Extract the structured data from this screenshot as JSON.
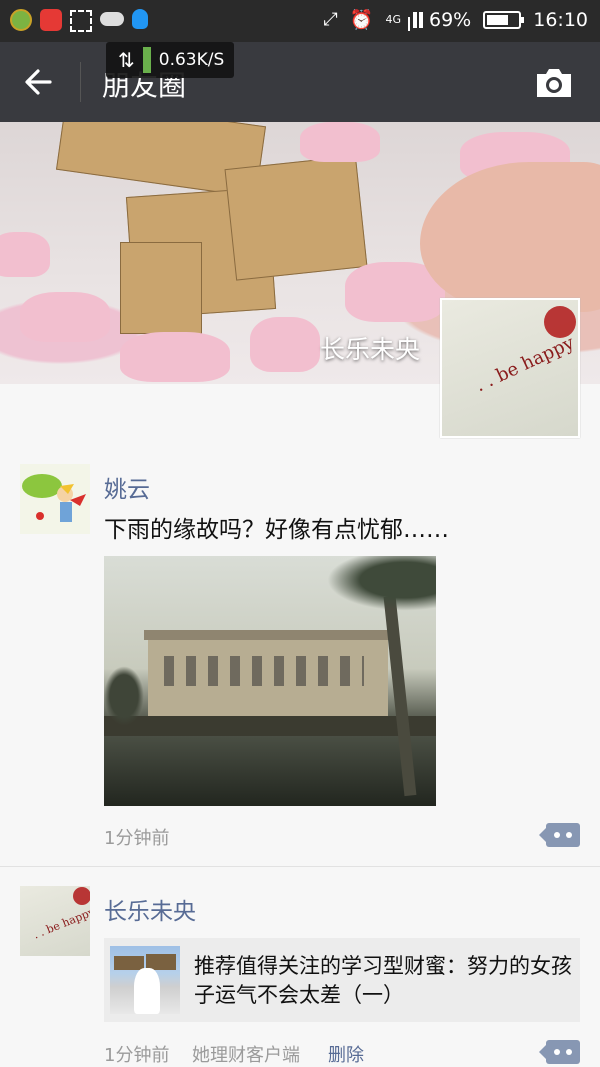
{
  "status_bar": {
    "battery_percent_label": "69%",
    "battery_level": 0.69,
    "time": "16:10",
    "network_label": "4G",
    "icons": [
      "app-icon-green",
      "app-icon-red",
      "screenshot-icon",
      "weather-icon",
      "qq-icon",
      "rotate-icon",
      "alarm-icon",
      "signal-icon"
    ]
  },
  "network_toast": {
    "speed": "0.63K/S"
  },
  "header": {
    "title": "朋友圈",
    "back_icon": "arrow-left-icon",
    "camera_icon": "camera-icon"
  },
  "cover": {
    "owner_name": "长乐未央"
  },
  "posts": [
    {
      "author": "姚云",
      "text": "下雨的缘故吗？好像有点忧郁……",
      "time": "1分钟前"
    },
    {
      "author": "长乐未央",
      "share_title": "推荐值得关注的学习型财蜜：努力的女孩子运气不会太差（一）",
      "time": "1分钟前",
      "source": "她理财客户端",
      "delete_label": "删除"
    }
  ],
  "colors": {
    "title_bar": "#393a3f",
    "status_bar": "#2a2a2a",
    "link_blue": "#576b95",
    "background": "#f7f7f7"
  }
}
